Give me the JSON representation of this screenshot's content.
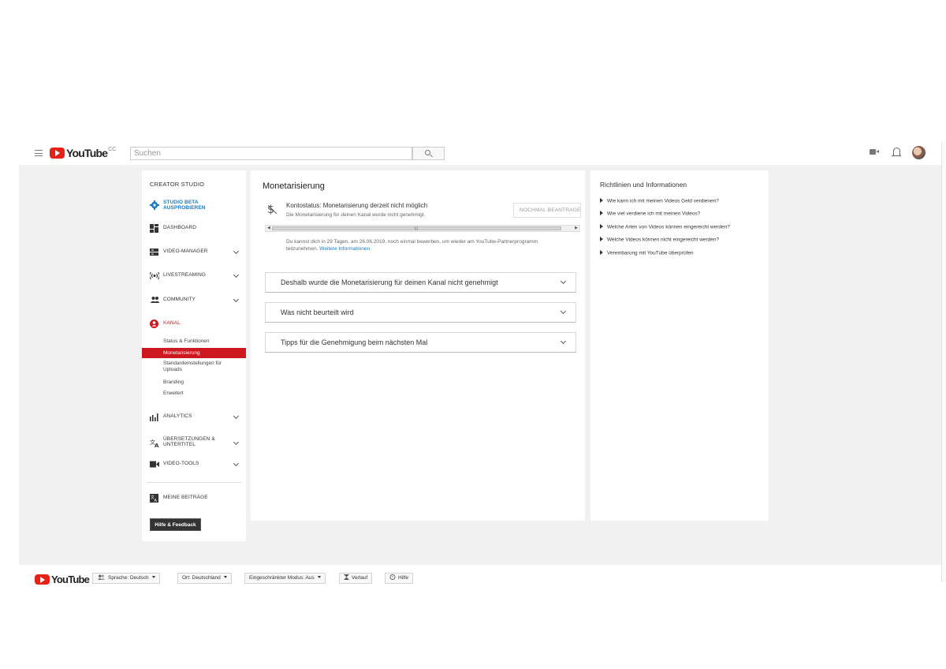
{
  "header": {
    "logo_text": "YouTube",
    "logo_suffix": "CC",
    "search_placeholder": "Suchen"
  },
  "sidebar": {
    "title": "CREATOR STUDIO",
    "beta_label_1": "STUDIO BETA",
    "beta_label_2": "AUSPROBIEREN",
    "items": [
      {
        "label": "DASHBOARD",
        "icon": "dashboard-icon"
      },
      {
        "label": "VIDEO-MANAGER",
        "icon": "video-manager-icon"
      },
      {
        "label": "LIVESTREAMING",
        "icon": "livestream-icon"
      },
      {
        "label": "COMMUNITY",
        "icon": "community-icon"
      },
      {
        "label": "KANAL",
        "icon": "channel-icon"
      },
      {
        "label": "ANALYTICS",
        "icon": "analytics-icon"
      },
      {
        "label": "ÜBERSETZUNGEN & UNTERTITEL",
        "icon": "translate-icon"
      },
      {
        "label": "VIDEO-TOOLS",
        "icon": "video-tools-icon"
      },
      {
        "label": "MEINE BEITRÄGE",
        "icon": "contributions-icon"
      }
    ],
    "sub_items": [
      "Status & Funktionen",
      "Monetarisierung",
      "Standardeinstellungen für Uploads",
      "Branding",
      "Erweitert"
    ],
    "help_button": "Hilfe & Feedback",
    "active_color": "#cc181e",
    "beta_color": "#167ac6"
  },
  "main": {
    "title": "Monetarisierung",
    "status_title": "Kontostatus: Monetarisierung derzeit nicht möglich",
    "status_sub": "Die Monetarisierung für deinen Kanal wurde nicht genehmigt.",
    "reapply_button": "NOCHMAL BEANTRAGEN",
    "info_text": "Du kannst dich in 29 Tagen, am 26.06.2019, noch einmal bewerben, um wieder am YouTube-Partnerprogramm teilzunehmen.",
    "info_link": "Weitere Informationen",
    "accordions": [
      "Deshalb wurde die Monetarisierung für deinen Kanal nicht genehmigt",
      "Was nicht beurteilt wird",
      "Tipps für die Genehmigung beim nächsten Mal"
    ]
  },
  "right": {
    "title": "Richtlinien und Informationen",
    "links": [
      "Wie kann ich mit meinen Videos Geld verdienen?",
      "Wie viel verdiene ich mit meinen Videos?",
      "Welche Arten von Videos können eingereicht werden?",
      "Welche Videos können nicht eingereicht werden?",
      "Vereinbarung mit YouTube überprüfen"
    ]
  },
  "footer": {
    "logo_text": "YouTube",
    "language": "Sprache: Deutsch",
    "location": "Ort: Deutschland",
    "restricted": "Eingeschränkter Modus: Aus",
    "history": "Verlauf",
    "help": "Hilfe"
  }
}
